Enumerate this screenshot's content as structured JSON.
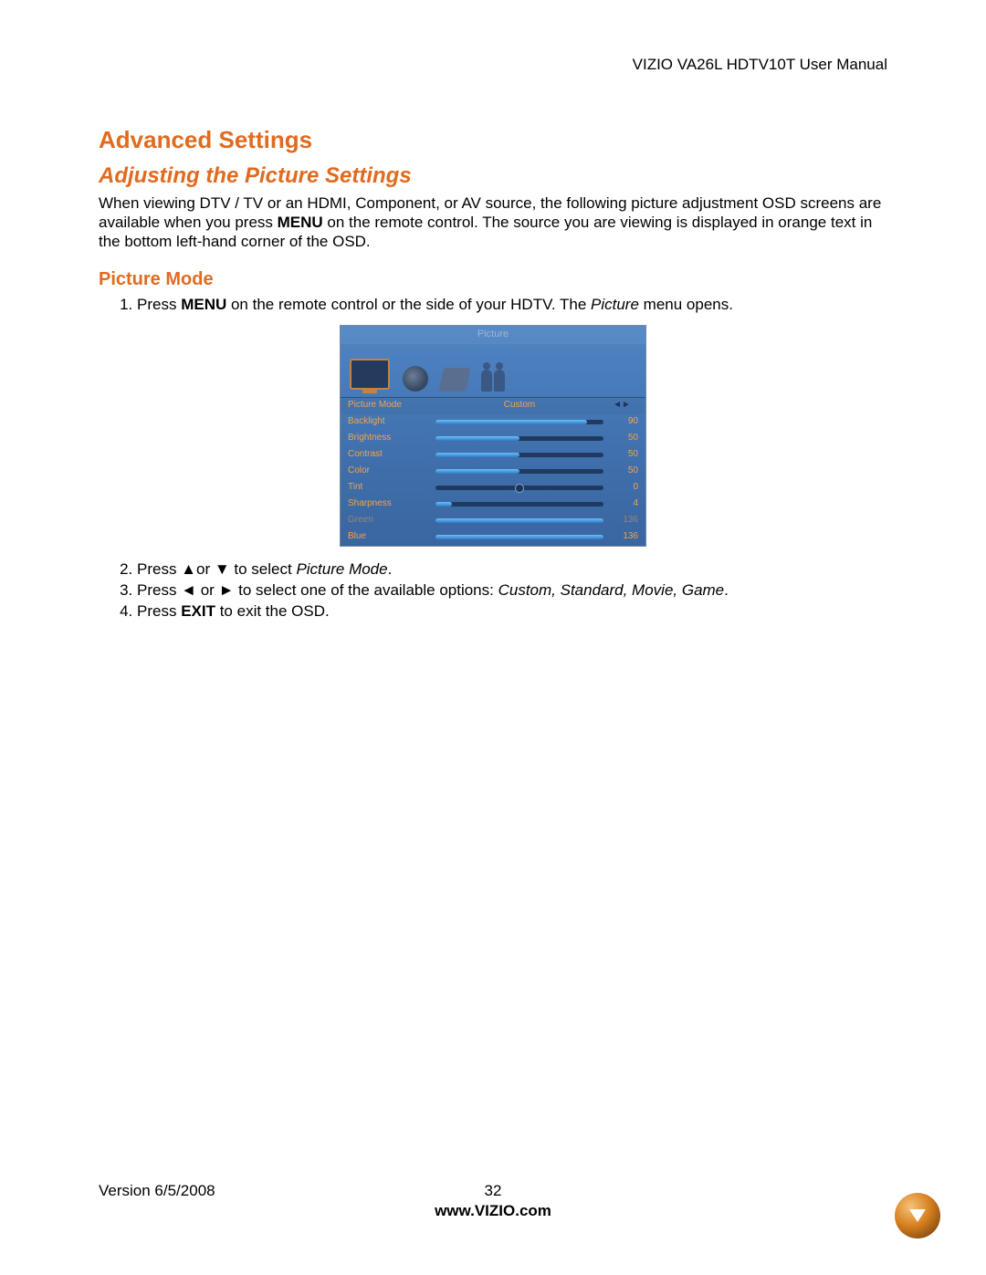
{
  "header": {
    "right": "VIZIO VA26L HDTV10T User Manual"
  },
  "h1": "Advanced Settings",
  "h2": "Adjusting the Picture Settings",
  "intro": {
    "p1a": "When viewing DTV / TV or an HDMI, Component, or AV source, the following picture adjustment OSD screens are available when you press ",
    "menu": "MENU",
    "p1b": " on the remote control. The source you are viewing is displayed in orange text in the bottom left-hand corner of the OSD."
  },
  "h3": "Picture Mode",
  "steps": {
    "s1a": "Press ",
    "s1b": " on the remote control or the side of your HDTV. The ",
    "s1word": "Picture",
    "s1c": " menu opens.",
    "s2a": "Press ▲or ▼ to select ",
    "s2ital": "Picture Mode",
    "s2b": ".",
    "s3a": "Press ◄ or ► to select one of the available options: ",
    "s3ital": "Custom, Standard, Movie, Game",
    "s3b": ".",
    "s4a": "Press ",
    "s4bold": "EXIT",
    "s4b": " to exit the OSD."
  },
  "osd": {
    "title": "Picture",
    "rows": [
      {
        "label": "Picture Mode",
        "text": "Custom",
        "arrows": "◄►"
      },
      {
        "label": "Backlight",
        "value": "90",
        "pct": 90
      },
      {
        "label": "Brightness",
        "value": "50",
        "pct": 50
      },
      {
        "label": "Contrast",
        "value": "50",
        "pct": 50
      },
      {
        "label": "Color",
        "value": "50",
        "pct": 50
      },
      {
        "label": "Tint",
        "value": "0",
        "pct": 50,
        "dot": true
      },
      {
        "label": "Sharpness",
        "value": "4",
        "pct": 10
      },
      {
        "label": "Green",
        "value": "136",
        "pct": 100,
        "dim": true
      },
      {
        "label": "Blue",
        "value": "136",
        "pct": 100
      }
    ]
  },
  "footer": {
    "version": "Version 6/5/2008",
    "page": "32",
    "site": "www.VIZIO.com"
  }
}
